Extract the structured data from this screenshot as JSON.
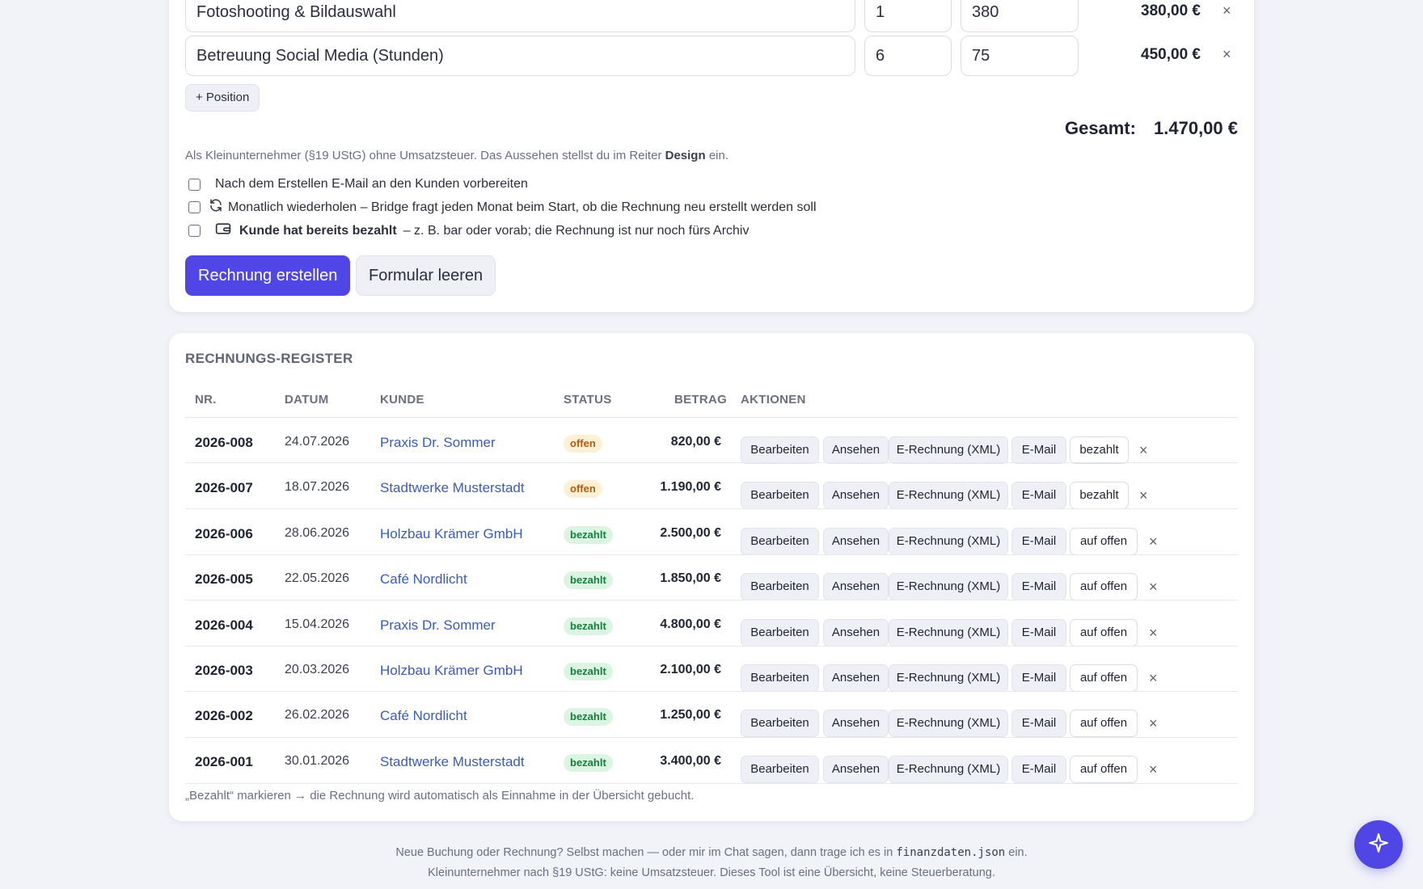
{
  "form": {
    "positions": [
      {
        "description": "Fotoshooting & Bildauswahl",
        "quantity": "1",
        "price": "380",
        "total": "380,00 €"
      },
      {
        "description": "Betreuung Social Media (Stunden)",
        "quantity": "6",
        "price": "75",
        "total": "450,00 €"
      }
    ],
    "add_position_label": "+ Position",
    "total_label": "Gesamt:",
    "total_value": "1.470,00 €",
    "hint_text": "Als Kleinunternehmer (§19 UStG) ohne Umsatzsteuer. Das Aussehen stellst du im Reiter",
    "hint_bold": "Design",
    "hint_end": "ein.",
    "options": [
      {
        "label": "Nach dem Erstellen E-Mail an den Kunden vorbereiten"
      },
      {
        "label": "Monatlich wiederholen – Bridge fragt jeden Monat beim Start, ob die Rechnung neu erstellt werden soll",
        "icon": "repeat-icon"
      },
      {
        "label_bold": "Kunde hat bereits bezahlt",
        "label": "– z. B. bar oder vorab; die Rechnung ist nur noch fürs Archiv",
        "icon": "wallet-icon"
      }
    ],
    "create_label": "Rechnung erstellen",
    "clear_label": "Formular leeren"
  },
  "register": {
    "title": "RECHNUNGS-REGISTER",
    "columns": {
      "nr": "NR.",
      "datum": "DATUM",
      "kunde": "KUNDE",
      "status": "STATUS",
      "betrag": "BETRAG",
      "aktionen": "AKTIONEN"
    },
    "action_labels": {
      "edit": "Bearbeiten",
      "view": "Ansehen",
      "xml": "E-Rechnung (XML)",
      "mail": "E-Mail",
      "mark_paid": "bezahlt",
      "mark_open": "auf offen",
      "delete": "×"
    },
    "rows": [
      {
        "nr": "2026-008",
        "datum": "24.07.2026",
        "kunde": "Praxis Dr. Sommer",
        "status": "offen",
        "betrag": "820,00 €"
      },
      {
        "nr": "2026-007",
        "datum": "18.07.2026",
        "kunde": "Stadtwerke Musterstadt",
        "status": "offen",
        "betrag": "1.190,00 €"
      },
      {
        "nr": "2026-006",
        "datum": "28.06.2026",
        "kunde": "Holzbau Krämer GmbH",
        "status": "bezahlt",
        "betrag": "2.500,00 €"
      },
      {
        "nr": "2026-005",
        "datum": "22.05.2026",
        "kunde": "Café Nordlicht",
        "status": "bezahlt",
        "betrag": "1.850,00 €"
      },
      {
        "nr": "2026-004",
        "datum": "15.04.2026",
        "kunde": "Praxis Dr. Sommer",
        "status": "bezahlt",
        "betrag": "4.800,00 €"
      },
      {
        "nr": "2026-003",
        "datum": "20.03.2026",
        "kunde": "Holzbau Krämer GmbH",
        "status": "bezahlt",
        "betrag": "2.100,00 €"
      },
      {
        "nr": "2026-002",
        "datum": "26.02.2026",
        "kunde": "Café Nordlicht",
        "status": "bezahlt",
        "betrag": "1.250,00 €"
      },
      {
        "nr": "2026-001",
        "datum": "30.01.2026",
        "kunde": "Stadtwerke Musterstadt",
        "status": "bezahlt",
        "betrag": "3.400,00 €"
      }
    ],
    "footnote": "„Bezahlt“ markieren → die Rechnung wird automatisch als Einnahme in der Übersicht gebucht."
  },
  "footer": {
    "line1_before": "Neue Buchung oder Rechnung? Selbst machen — oder mir im Chat sagen, dann trage ich es in",
    "line1_code": "finanzdaten.json",
    "line1_after": "ein.",
    "line2": "Kleinunternehmer nach §19 UStG: keine Umsatzsteuer. Dieses Tool ist eine Übersicht, keine Steuerberatung."
  },
  "fab": {
    "icon": "sparkle-icon"
  },
  "colors": {
    "accent": "#4f46e5",
    "link": "#3b5bb8",
    "open_badge": "#b45a0a",
    "paid_badge": "#15803d"
  }
}
